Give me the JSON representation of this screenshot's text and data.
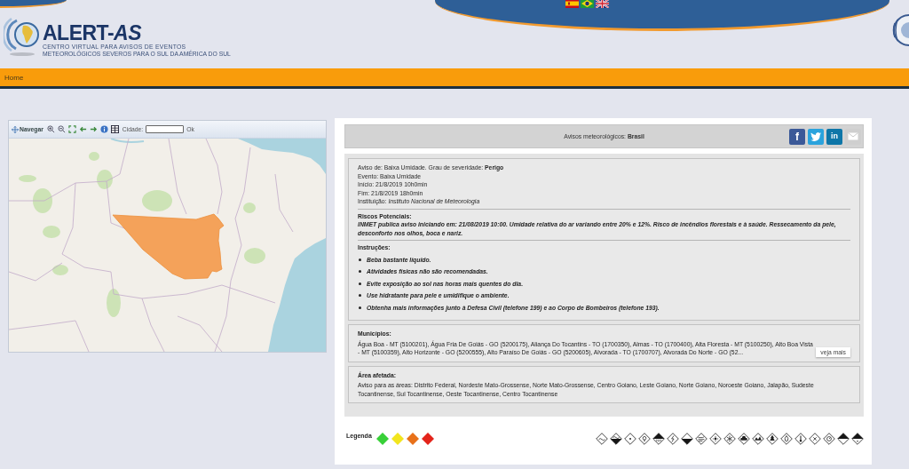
{
  "header": {
    "logo": {
      "title": "ALERT-*AS*",
      "subtitle": "CENTRO VIRTUAL PARA AVISOS DE EVENTOS",
      "tagline": "METEOROLÓGICOS SEVEROS PARA O SUL DA AMÉRICA DO SUL"
    },
    "languages": [
      {
        "kind": "spanish"
      },
      {
        "kind": "portuguese"
      },
      {
        "kind": "english"
      }
    ]
  },
  "nav": {
    "items": [
      {
        "label": "Home"
      }
    ]
  },
  "map_panel": {
    "toolbar": [
      {
        "kind": "pan",
        "label": "Navegar"
      },
      {
        "kind": "zoom_in"
      },
      {
        "kind": "zoom_out"
      },
      {
        "kind": "extent"
      },
      {
        "kind": "previous"
      },
      {
        "kind": "next"
      },
      {
        "kind": "info"
      },
      {
        "kind": "table"
      },
      {
        "kind": "label",
        "label": "Cidade:"
      },
      {
        "kind": "field"
      },
      {
        "kind": "submit",
        "label": "Ok"
      }
    ]
  },
  "alert_panel": {
    "title": "Avisos meteorológicos: **Brasil**",
    "share": [
      {
        "kind": "facebook",
        "label": "f"
      },
      {
        "kind": "twitter"
      },
      {
        "kind": "linkedin",
        "label": "in"
      },
      {
        "kind": "email"
      }
    ],
    "details": [
      "Aviso de: Baixa Umidade. Grau de severidade: **Perigo**",
      "Evento: Baixa Umidade",
      "Início: 21/8/2019 10h0min",
      "Fim: 21/8/2019 18h0min",
      "Instituição: *Instituto Nacional de Meteorologia*"
    ],
    "risks": {
      "heading": "Riscos Potenciais:",
      "text": "INMET publica aviso iniciando em: 21/08/2019 10:00. Umidade relativa do ar variando entre 20% e 12%. Risco de incêndios florestais e à saúde. Ressecamento da pele, desconforto nos olhos, boca e nariz."
    },
    "instructions": {
      "heading": "Instruções:",
      "items": [
        "Beba bastante líquido.",
        "Atividades físicas não são recomendadas.",
        "Evite exposição ao sol nas horas mais quentes do dia.",
        "Use hidratante para pele e umidifique o ambiente.",
        "Obtenha mais informações junto à Defesa Civil (telefone 199) e ao Corpo de Bombeiros (telefone 193)."
      ]
    },
    "municipalities": {
      "heading": "Municípios:",
      "text": "Água Boa - MT (5100201), Água Fria De Goiás - GO (5200175), Aliança Do Tocantins - TO (1700350), Almas - TO (1700400), Alta Floresta - MT (5100250), Alto Boa Vista - MT (5100359), Alto Horizonte - GO (5200555), Alto Paraíso De Goiás - GO (5200605), Alvorada - TO (1700707), Alvorada Do Norte - GO (52...",
      "more_button": "veja mais"
    },
    "affected_area": {
      "heading": "Área afetada:",
      "text": "Aviso para as áreas: Distrito Federal, Nordeste Mato-Grossense, Norte Mato-Grossense, Centro Goiano, Leste Goiano, Norte Goiano, Noroeste Goiano, Jalapão, Sudeste Tocantinense, Sul Tocantinense, Oeste Tocantinense, Centro Tocantinense"
    }
  },
  "legend": {
    "label": "Legenda",
    "levels": [
      {
        "color": "#38d038"
      },
      {
        "color": "#f2e51e"
      },
      {
        "color": "#e8711a"
      },
      {
        "color": "#e3241b"
      }
    ]
  }
}
